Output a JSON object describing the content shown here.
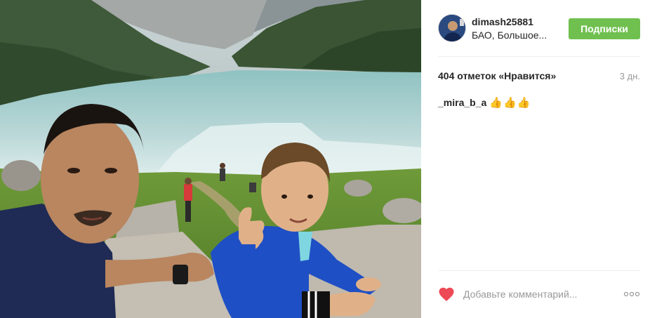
{
  "post": {
    "username": "dimash25881",
    "location": "БАО, Большое...",
    "follow_label": "Подписки",
    "likes": "404 отметок «Нравится»",
    "time_ago": "3 дн.",
    "comments": [
      {
        "user": "_mira_b_a",
        "text": "👍👍👍"
      }
    ],
    "comment_placeholder": "Добавьте комментарий...",
    "photo_description_icon": "photo"
  },
  "colors": {
    "follow_button": "#70c050",
    "heart": "#ed4956",
    "muted_text": "#999999"
  }
}
